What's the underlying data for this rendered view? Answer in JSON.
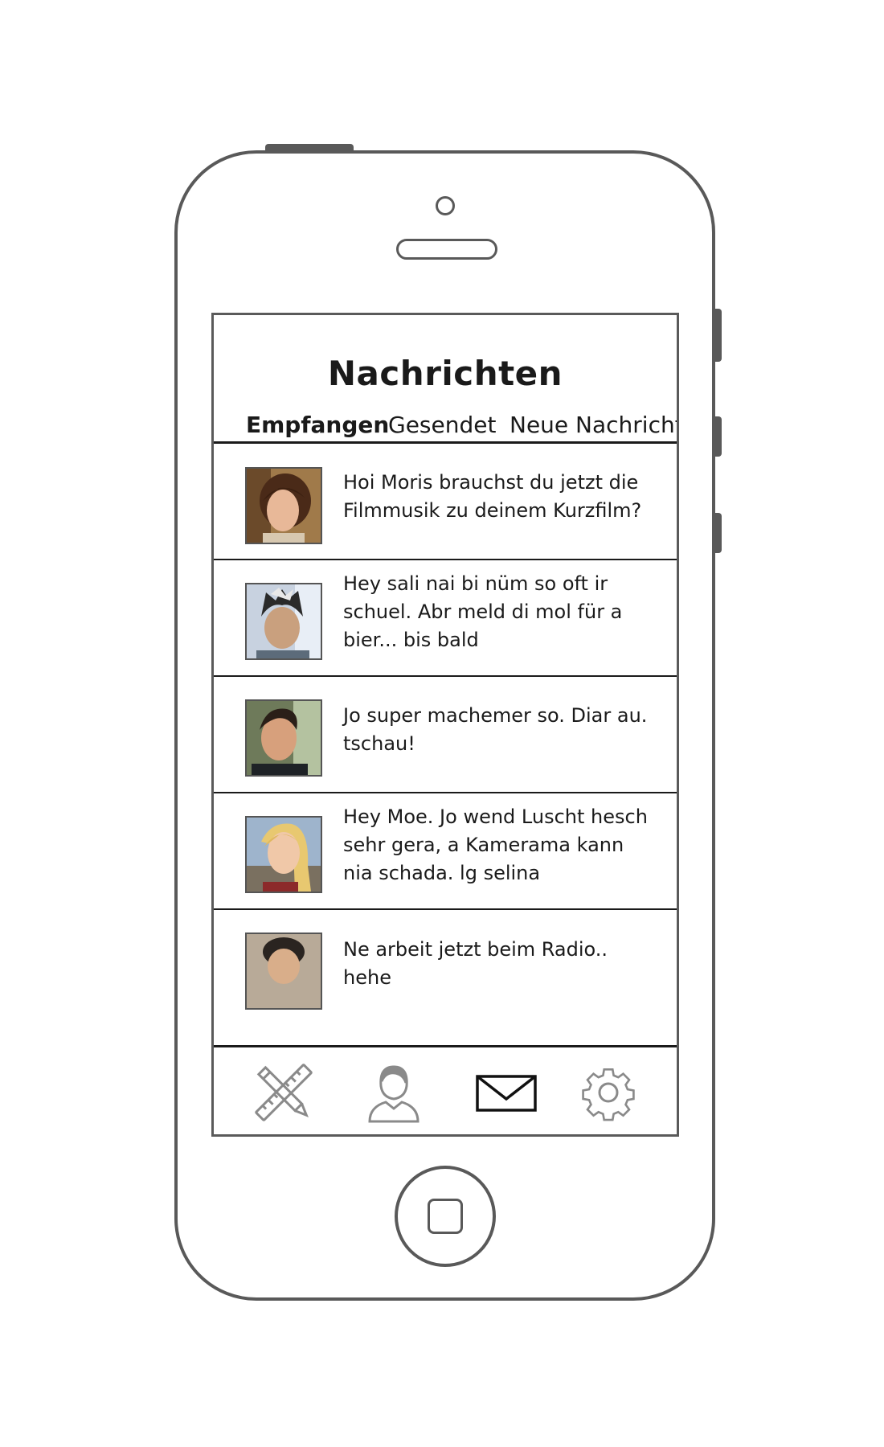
{
  "header": {
    "title": "Nachrichten"
  },
  "tabs": [
    {
      "label": "Empfangen",
      "active": true
    },
    {
      "label": "Gesendet",
      "active": false
    },
    {
      "label": "Neue Nachricht",
      "active": false
    }
  ],
  "messages": [
    {
      "text": "Hoi Moris brauchst du jetzt die Filmmusik zu deinem Kurzfilm?"
    },
    {
      "text": "Hey sali nai bi nüm so oft ir schuel. Abr meld di mol für a bier... bis bald"
    },
    {
      "text": "Jo super machemer so. Diar au. tschau!"
    },
    {
      "text": "Hey Moe. Jo wend Luscht hesch sehr gera, a Kamerama kann nia schada. lg selina"
    },
    {
      "text": "Ne arbeit jetzt beim Radio.. hehe"
    }
  ],
  "bottom_nav": [
    {
      "icon": "ruler-pencil-icon",
      "active": false
    },
    {
      "icon": "user-icon",
      "active": false
    },
    {
      "icon": "envelope-icon",
      "active": true
    },
    {
      "icon": "gear-icon",
      "active": false
    }
  ],
  "colors": {
    "frame": "#595959",
    "text": "#1a1a1a",
    "inactive_icon": "#8a8a8a"
  }
}
